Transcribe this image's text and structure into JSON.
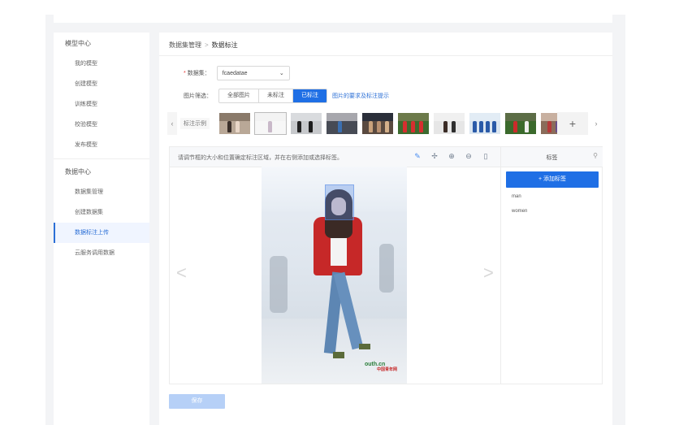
{
  "sidebar": {
    "groups": [
      {
        "title": "模型中心",
        "items": [
          "我的模型",
          "创建模型",
          "训练模型",
          "校验模型",
          "发布模型"
        ]
      },
      {
        "title": "数据中心",
        "items": [
          "数据集管理",
          "创建数据集",
          "数据标注上传",
          "云服务调用数据"
        ]
      }
    ],
    "active_item": "数据标注上传"
  },
  "breadcrumb": {
    "parent": "数据集管理",
    "separator": ">",
    "current": "数据标注"
  },
  "dataset": {
    "label": "数据集：",
    "value": "fcaedatae"
  },
  "filter": {
    "label": "图片筛选：",
    "options": [
      "全部图片",
      "未标注",
      "已标注"
    ],
    "selected": "已标注",
    "requirements_link": "图片的要求及标注提示"
  },
  "thumbnails": {
    "example_label": "标注示例",
    "count": 10,
    "add_icon": "plus-icon"
  },
  "toolbar": {
    "tip": "请调节框的大小和位置确定标注区域，并在右侧添加或选择标签。",
    "tools": [
      "edit-icon",
      "move-icon",
      "zoom-in-icon",
      "zoom-out-icon",
      "delete-icon"
    ]
  },
  "label_panel": {
    "title": "标签",
    "add_button": "+ 添加标签",
    "labels": [
      "man",
      "women"
    ]
  },
  "photo": {
    "watermark": "outh.cn",
    "watermark_cn": "中国青年网"
  },
  "save_button": "保存",
  "colors": {
    "accent": "#1f6fe5",
    "save_disabled": "#b6d0f7",
    "bbox": "#5a8ce6"
  }
}
